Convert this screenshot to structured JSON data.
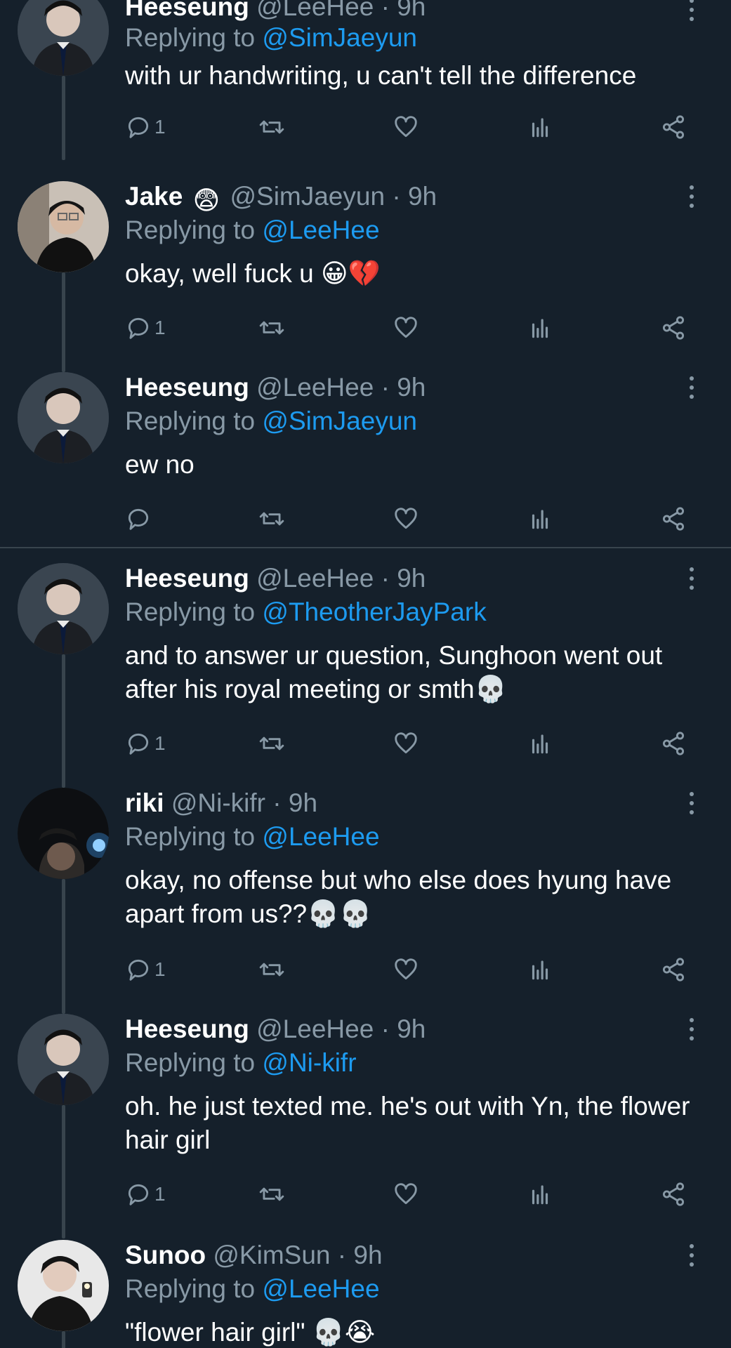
{
  "tweets": [
    {
      "name": "Heeseung",
      "handle": "@LeeHee",
      "dot": "·",
      "time": "9h",
      "reply_prefix": "Replying to",
      "reply_to": "@SimJaeyun",
      "text": "with ur handwriting, u can't tell the difference",
      "replies": "1"
    },
    {
      "name": "Jake",
      "badge_emoji": "😨",
      "handle": "@SimJaeyun",
      "dot": "·",
      "time": "9h",
      "reply_prefix": "Replying to",
      "reply_to": "@LeeHee",
      "text": "okay, well fuck u 😀💔",
      "replies": "1"
    },
    {
      "name": "Heeseung",
      "handle": "@LeeHee",
      "dot": "·",
      "time": "9h",
      "reply_prefix": "Replying to",
      "reply_to": "@SimJaeyun",
      "text": "ew no",
      "replies": ""
    },
    {
      "name": "Heeseung",
      "handle": "@LeeHee",
      "dot": "·",
      "time": "9h",
      "reply_prefix": "Replying to",
      "reply_to": "@TheotherJayPark",
      "text": "and to answer ur question, Sunghoon went out after his royal meeting or smth💀",
      "replies": "1"
    },
    {
      "name": "riki",
      "handle": "@Ni-kifr",
      "dot": "·",
      "time": "9h",
      "reply_prefix": "Replying to",
      "reply_to": "@LeeHee",
      "text": "okay, no offense but who else does hyung have apart from us??💀💀",
      "replies": "1"
    },
    {
      "name": "Heeseung",
      "handle": "@LeeHee",
      "dot": "·",
      "time": "9h",
      "reply_prefix": "Replying to",
      "reply_to": "@Ni-kifr",
      "text": "oh. he just texted me. he's out with Yn, the flower hair girl",
      "replies": "1"
    },
    {
      "name": "Sunoo",
      "handle": "@KimSun",
      "dot": "·",
      "time": "9h",
      "reply_prefix": "Replying to",
      "reply_to": "@LeeHee",
      "text": "\"flower hair girl\" 💀😭",
      "replies": ""
    }
  ],
  "icons": {
    "reply": "reply-icon",
    "retweet": "retweet-icon",
    "like": "heart-icon",
    "analytics": "analytics-icon",
    "share": "share-icon",
    "more": "more-options-icon"
  },
  "colors": {
    "background": "#15202b",
    "muted": "#8899a6",
    "mention": "#1d9bf0",
    "line": "#38444d"
  }
}
